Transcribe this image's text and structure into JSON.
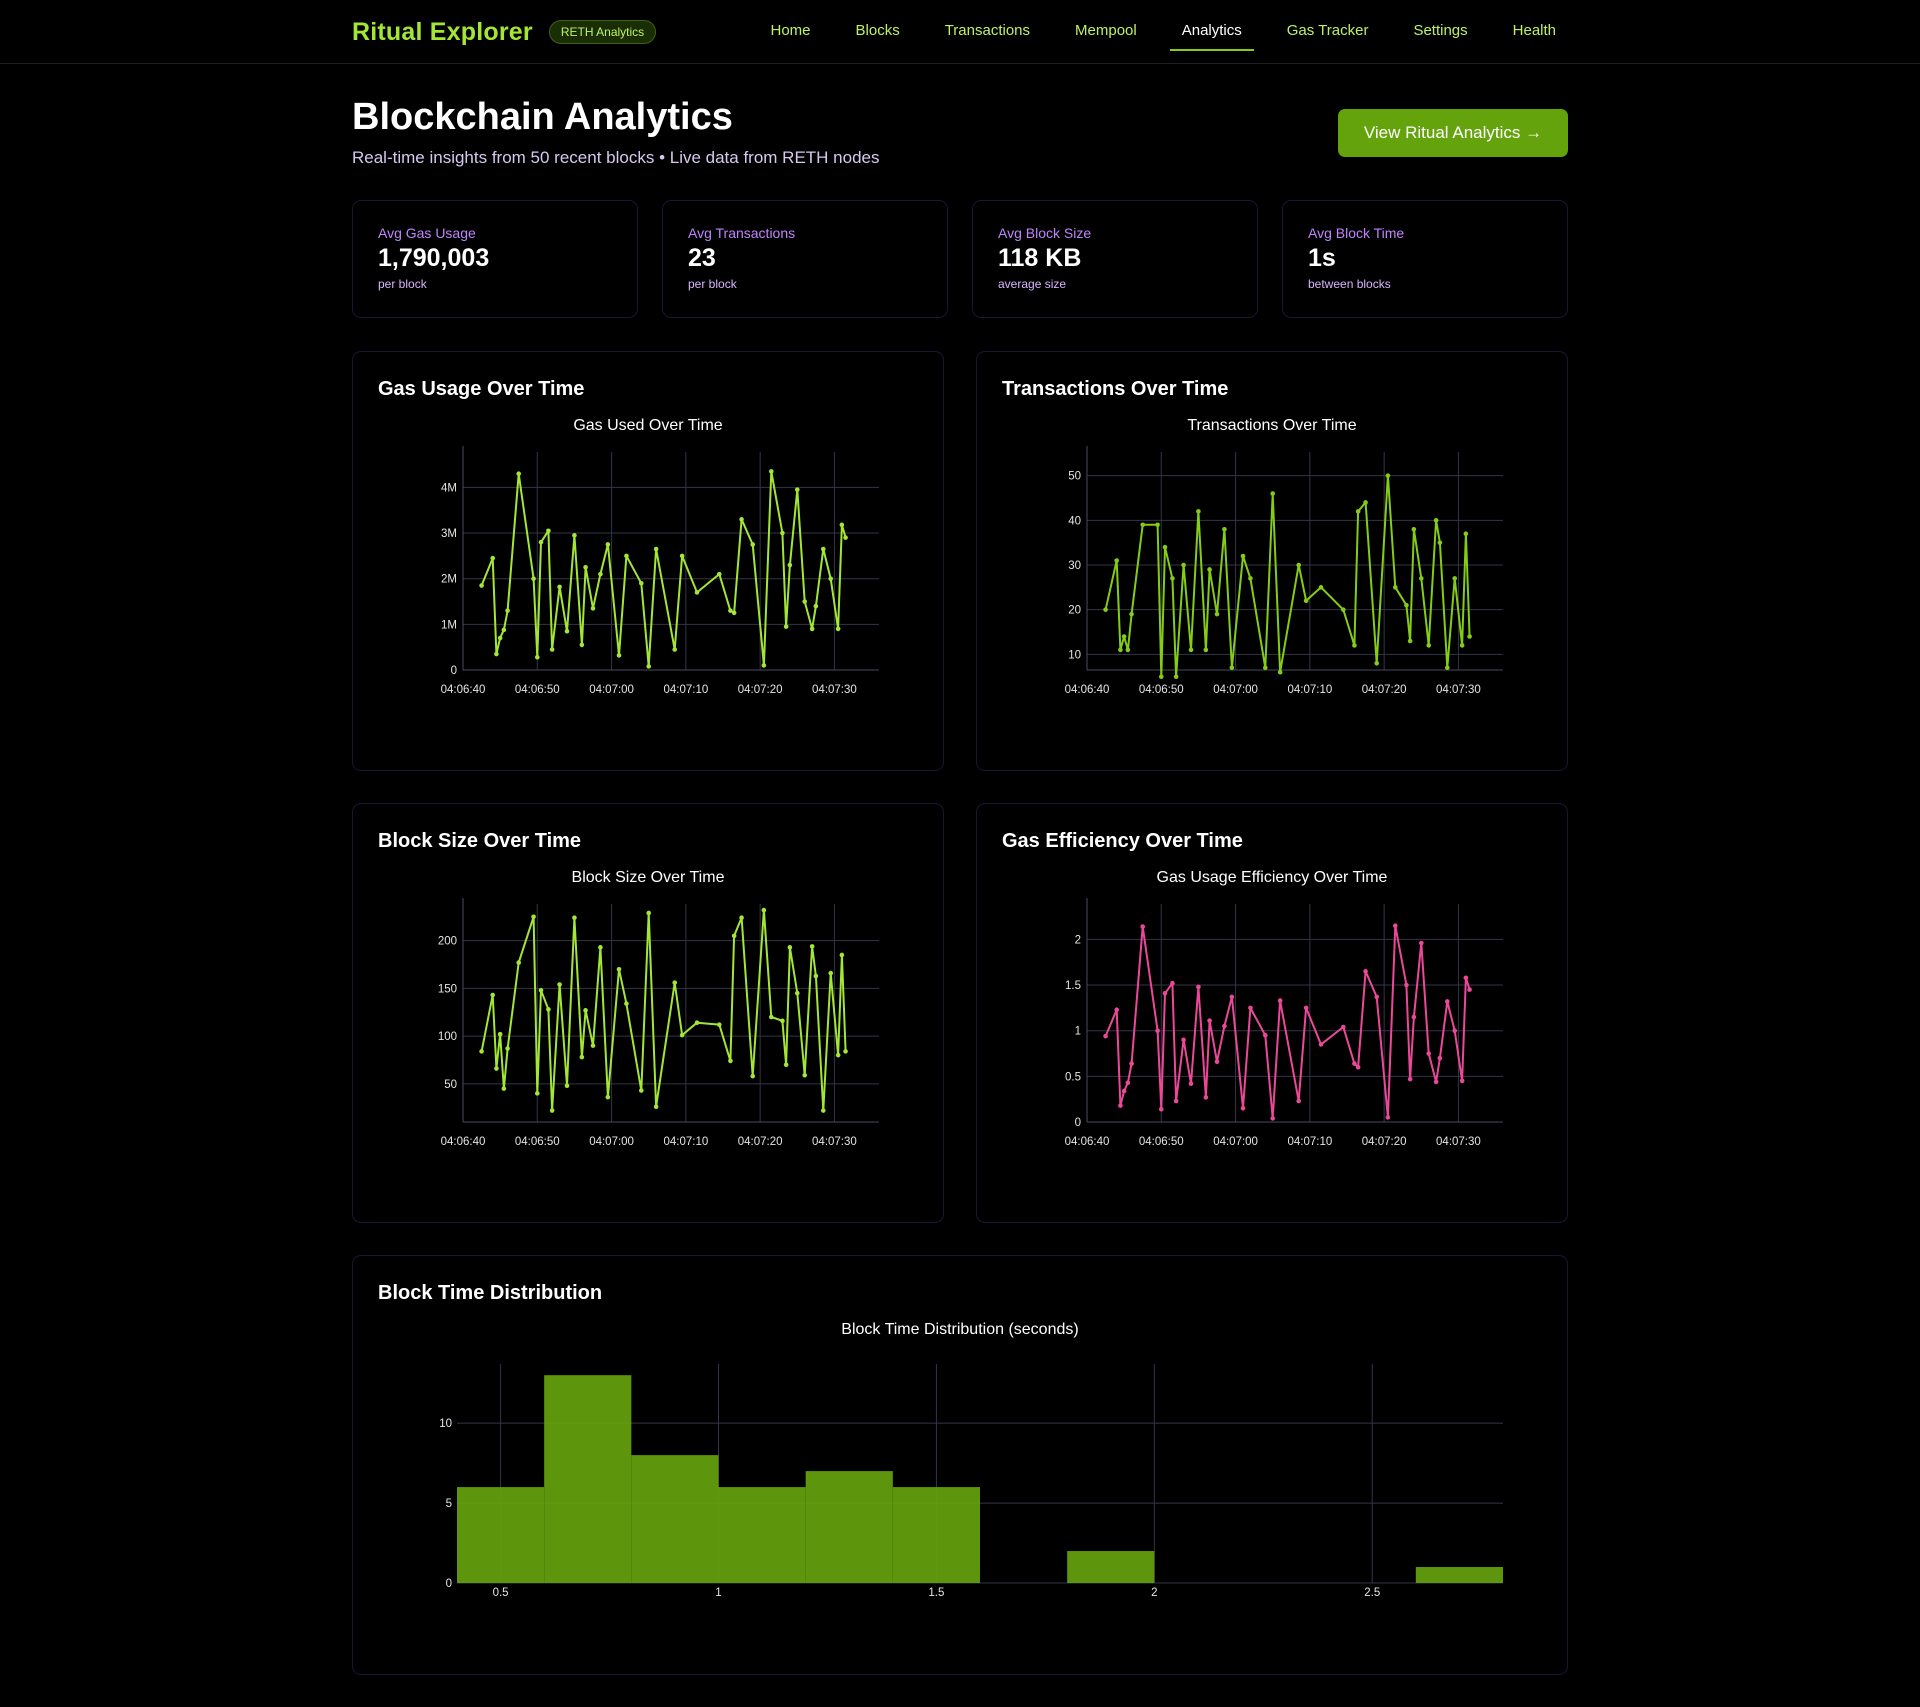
{
  "nav": {
    "brand": "Ritual Explorer",
    "badge": "RETH Analytics",
    "links": [
      "Home",
      "Blocks",
      "Transactions",
      "Mempool",
      "Analytics",
      "Gas Tracker",
      "Settings",
      "Health"
    ],
    "active": "Analytics"
  },
  "header": {
    "title": "Blockchain Analytics",
    "subtitle": "Real-time insights from 50 recent blocks • Live data from RETH nodes",
    "cta": "View Ritual Analytics →"
  },
  "stats": [
    {
      "label": "Avg Gas Usage",
      "value": "1,790,003",
      "sub": "per block"
    },
    {
      "label": "Avg Transactions",
      "value": "23",
      "sub": "per block"
    },
    {
      "label": "Avg Block Size",
      "value": "118 KB",
      "sub": "average size"
    },
    {
      "label": "Avg Block Time",
      "value": "1s",
      "sub": "between blocks"
    }
  ],
  "panels": {
    "gas": "Gas Usage Over Time",
    "tx": "Transactions Over Time",
    "size": "Block Size Over Time",
    "eff": "Gas Efficiency Over Time",
    "dist": "Block Time Distribution"
  },
  "colors": {
    "green": "#a3e635",
    "green_dark": "#65a30d",
    "pink": "#ec4899",
    "purple": "#c084fc"
  },
  "chart_data": [
    {
      "type": "line",
      "title": "Gas Used Over Time",
      "xlabel": "",
      "ylabel": "",
      "x_ticks": [
        "04:06:40",
        "04:06:50",
        "04:07:00",
        "04:07:10",
        "04:07:20",
        "04:07:30"
      ],
      "y_ticks": [
        "0",
        "1M",
        "2M",
        "3M",
        "4M"
      ],
      "x_range_seconds": [
        0,
        56
      ],
      "ylim": [
        0,
        4600000
      ],
      "x": [
        2.5,
        4,
        4.5,
        5,
        5.5,
        6,
        7.5,
        9.5,
        10,
        10.5,
        11.5,
        12,
        13,
        14,
        15,
        16,
        16.5,
        17.5,
        18.5,
        19.5,
        21,
        22,
        24,
        25,
        26,
        28.5,
        29.5,
        31.5,
        34.5,
        36,
        36.5,
        37.5,
        39,
        40.5,
        41.5,
        43,
        43.5,
        44,
        45,
        46,
        47,
        47.5,
        48.5,
        49.5,
        50.5,
        51,
        51.5
      ],
      "y": [
        1850000,
        2450000,
        350000,
        700000,
        880000,
        1300000,
        4300000,
        2000000,
        280000,
        2800000,
        3050000,
        450000,
        1820000,
        850000,
        2950000,
        550000,
        2250000,
        1350000,
        2100000,
        2750000,
        320000,
        2500000,
        1900000,
        80000,
        2650000,
        450000,
        2500000,
        1700000,
        2100000,
        1300000,
        1250000,
        3300000,
        2750000,
        100000,
        4350000,
        3000000,
        950000,
        2300000,
        3950000,
        1500000,
        900000,
        1400000,
        2650000,
        2000000,
        900000,
        3180000,
        2900000
      ],
      "series": [
        {
          "color": "#a3e635"
        }
      ]
    },
    {
      "type": "line",
      "title": "Transactions Over Time",
      "xlabel": "",
      "ylabel": "",
      "x_ticks": [
        "04:06:40",
        "04:06:50",
        "04:07:00",
        "04:07:10",
        "04:07:20",
        "04:07:30"
      ],
      "y_ticks": [
        "10",
        "20",
        "30",
        "40",
        "50"
      ],
      "x_range_seconds": [
        0,
        56
      ],
      "ylim": [
        6.5,
        53.5
      ],
      "x": [
        2.5,
        4,
        4.5,
        5,
        5.5,
        6,
        7.5,
        9.5,
        10,
        10.5,
        11.5,
        12,
        13,
        14,
        15,
        16,
        16.5,
        17.5,
        18.5,
        19.5,
        21,
        22,
        24,
        25,
        26,
        28.5,
        29.5,
        31.5,
        34.5,
        36,
        36.5,
        37.5,
        39,
        40.5,
        41.5,
        43,
        43.5,
        44,
        45,
        46,
        47,
        47.5,
        48.5,
        49.5,
        50.5,
        51,
        51.5
      ],
      "y": [
        20,
        31,
        11,
        14,
        11,
        19,
        39,
        39,
        5,
        34,
        27,
        5,
        30,
        11,
        42,
        11,
        29,
        19,
        38,
        7,
        32,
        27,
        7,
        46,
        6,
        30,
        22,
        25,
        20,
        12,
        42,
        44,
        8,
        50,
        25,
        21,
        13,
        38,
        27,
        12,
        40,
        35,
        7,
        27,
        12,
        37,
        14
      ],
      "series": [
        {
          "color": "#84cc16"
        }
      ]
    },
    {
      "type": "line",
      "title": "Block Size Over Time",
      "xlabel": "",
      "ylabel": "",
      "x_ticks": [
        "04:06:40",
        "04:06:50",
        "04:07:00",
        "04:07:10",
        "04:07:20",
        "04:07:30"
      ],
      "y_ticks": [
        "50",
        "100",
        "150",
        "200"
      ],
      "x_range_seconds": [
        0,
        56
      ],
      "ylim": [
        10,
        230
      ],
      "x": [
        2.5,
        4,
        4.5,
        5,
        5.5,
        6,
        7.5,
        9.5,
        10,
        10.5,
        11.5,
        12,
        13,
        14,
        15,
        16,
        16.5,
        17.5,
        18.5,
        19.5,
        21,
        22,
        24,
        25,
        26,
        28.5,
        29.5,
        31.5,
        34.5,
        36,
        36.5,
        37.5,
        39,
        40.5,
        41.5,
        43,
        43.5,
        44,
        45,
        46,
        47,
        47.5,
        48.5,
        49.5,
        50.5,
        51,
        51.5
      ],
      "y": [
        84,
        143,
        66,
        102,
        45,
        87,
        177,
        225,
        40,
        148,
        128,
        22,
        154,
        48,
        224,
        78,
        127,
        90,
        193,
        36,
        170,
        134,
        43,
        229,
        26,
        156,
        101,
        114,
        112,
        74,
        205,
        224,
        58,
        232,
        120,
        116,
        70,
        193,
        145,
        59,
        194,
        163,
        22,
        166,
        80,
        185,
        84
      ],
      "series": [
        {
          "color": "#a3e635"
        }
      ]
    },
    {
      "type": "line",
      "title": "Gas Usage Efficiency Over Time",
      "xlabel": "",
      "ylabel": "",
      "x_ticks": [
        "04:06:40",
        "04:06:50",
        "04:07:00",
        "04:07:10",
        "04:07:20",
        "04:07:30"
      ],
      "y_ticks": [
        "0",
        "0.5",
        "1",
        "1.5",
        "2"
      ],
      "x_range_seconds": [
        0,
        56
      ],
      "ylim": [
        0,
        2.3
      ],
      "x": [
        2.5,
        4,
        4.5,
        5,
        5.5,
        6,
        7.5,
        9.5,
        10,
        10.5,
        11.5,
        12,
        13,
        14,
        15,
        16,
        16.5,
        17.5,
        18.5,
        19.5,
        21,
        22,
        24,
        25,
        26,
        28.5,
        29.5,
        31.5,
        34.5,
        36,
        36.5,
        37.5,
        39,
        40.5,
        41.5,
        43,
        43.5,
        44,
        45,
        46,
        47,
        47.5,
        48.5,
        49.5,
        50.5,
        51,
        51.5
      ],
      "y": [
        0.94,
        1.23,
        0.18,
        0.34,
        0.43,
        0.64,
        2.14,
        1.0,
        0.14,
        1.41,
        1.52,
        0.23,
        0.9,
        0.42,
        1.48,
        0.27,
        1.11,
        0.66,
        1.05,
        1.37,
        0.15,
        1.25,
        0.95,
        0.04,
        1.33,
        0.23,
        1.25,
        0.85,
        1.04,
        0.64,
        0.6,
        1.65,
        1.37,
        0.05,
        2.15,
        1.5,
        0.47,
        1.15,
        1.96,
        0.75,
        0.44,
        0.7,
        1.32,
        1.0,
        0.45,
        1.58,
        1.45
      ],
      "series": [
        {
          "color": "#ec4899"
        }
      ]
    },
    {
      "type": "bar",
      "title": "Block Time Distribution (seconds)",
      "xlabel": "",
      "ylabel": "",
      "x_ticks": [
        "0.5",
        "1",
        "1.5",
        "2",
        "2.5"
      ],
      "y_ticks": [
        "0",
        "5",
        "10"
      ],
      "xlim": [
        0.4,
        2.8
      ],
      "ylim": [
        0,
        13.7
      ],
      "bins": [
        [
          0.4,
          0.6
        ],
        [
          0.6,
          0.8
        ],
        [
          0.8,
          1.0
        ],
        [
          1.0,
          1.2
        ],
        [
          1.2,
          1.4
        ],
        [
          1.4,
          1.6
        ],
        [
          1.8,
          2.0
        ],
        [
          2.6,
          2.8
        ]
      ],
      "values": [
        6,
        13,
        8,
        6,
        7,
        6,
        2,
        1
      ],
      "series": [
        {
          "color": "#65a30d"
        }
      ]
    }
  ]
}
